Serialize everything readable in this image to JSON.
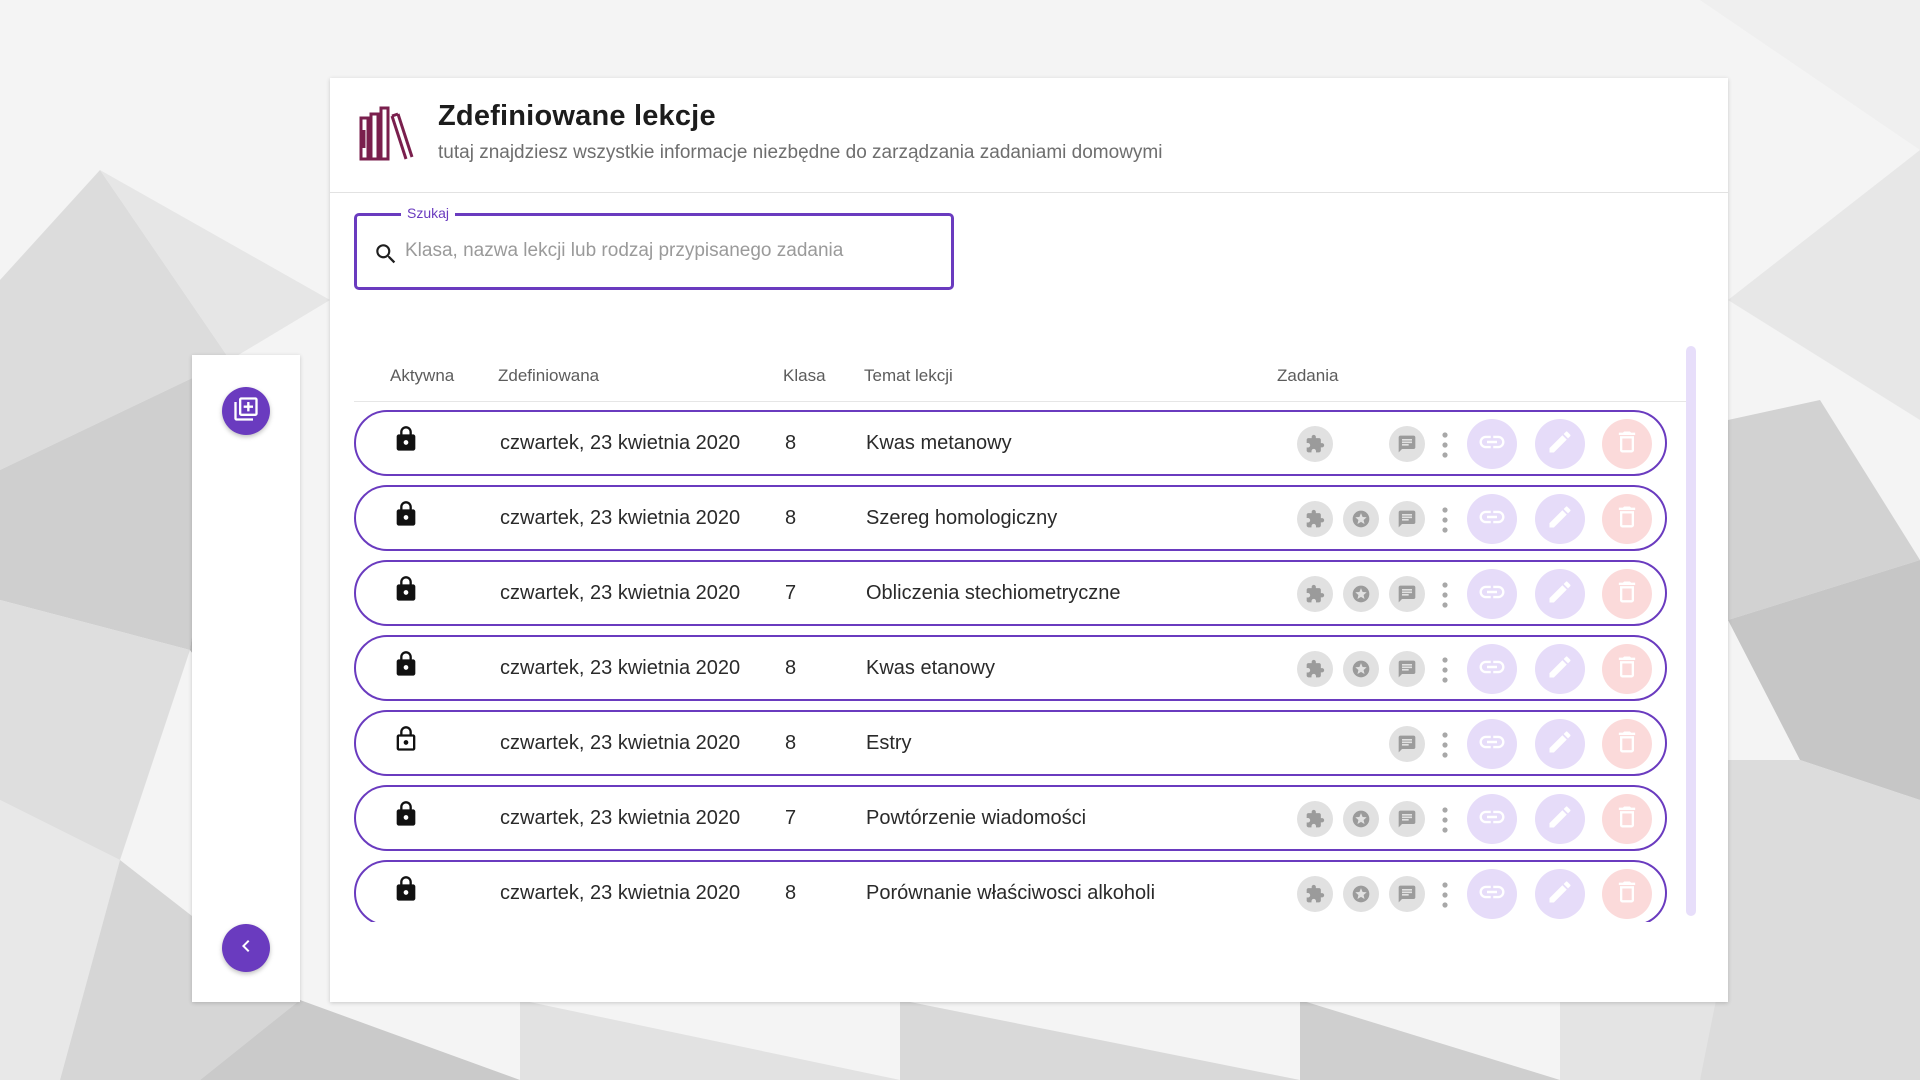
{
  "header": {
    "title": "Zdefiniowane lekcje",
    "subtitle": "tutaj znajdziesz wszystkie informacje niezbędne do zarządzania zadaniami domowymi",
    "logo_icon": "books-icon"
  },
  "search": {
    "label": "Szukaj",
    "placeholder": "Klasa, nazwa lekcji lub rodzaj przypisanego zadania",
    "value": ""
  },
  "sidebar": {
    "add_icon": "add-library-icon",
    "back_icon": "chevron-left-icon"
  },
  "table": {
    "columns": {
      "active": "Aktywna",
      "defined": "Zdefiniowana",
      "class": "Klasa",
      "topic": "Temat lekcji",
      "tasks": "Zadania"
    },
    "rows": [
      {
        "locked": true,
        "date": "czwartek, 23 kwietnia 2020",
        "class": "8",
        "topic": "Kwas metanowy",
        "tasks": [
          "puzzle",
          "comment"
        ]
      },
      {
        "locked": true,
        "date": "czwartek, 23 kwietnia 2020",
        "class": "8",
        "topic": "Szereg homologiczny",
        "tasks": [
          "puzzle",
          "star",
          "comment"
        ]
      },
      {
        "locked": true,
        "date": "czwartek, 23 kwietnia 2020",
        "class": "7",
        "topic": "Obliczenia stechiometryczne",
        "tasks": [
          "puzzle",
          "star",
          "comment"
        ]
      },
      {
        "locked": true,
        "date": "czwartek, 23 kwietnia 2020",
        "class": "8",
        "topic": "Kwas etanowy",
        "tasks": [
          "puzzle",
          "star",
          "comment"
        ]
      },
      {
        "locked": false,
        "date": "czwartek, 23 kwietnia 2020",
        "class": "8",
        "topic": "Estry",
        "tasks": [
          "comment"
        ]
      },
      {
        "locked": true,
        "date": "czwartek, 23 kwietnia 2020",
        "class": "7",
        "topic": "Powtórzenie wiadomości",
        "tasks": [
          "puzzle",
          "star",
          "comment"
        ]
      },
      {
        "locked": true,
        "date": "czwartek, 23 kwietnia 2020",
        "class": "8",
        "topic": "Porównanie właściwosci alkoholi",
        "tasks": [
          "puzzle",
          "star",
          "comment"
        ]
      }
    ]
  },
  "colors": {
    "accent": "#6a3bbf",
    "action_light": "#e6dcf9",
    "delete_light": "#fbdada",
    "logo": "#7a1f4d"
  }
}
